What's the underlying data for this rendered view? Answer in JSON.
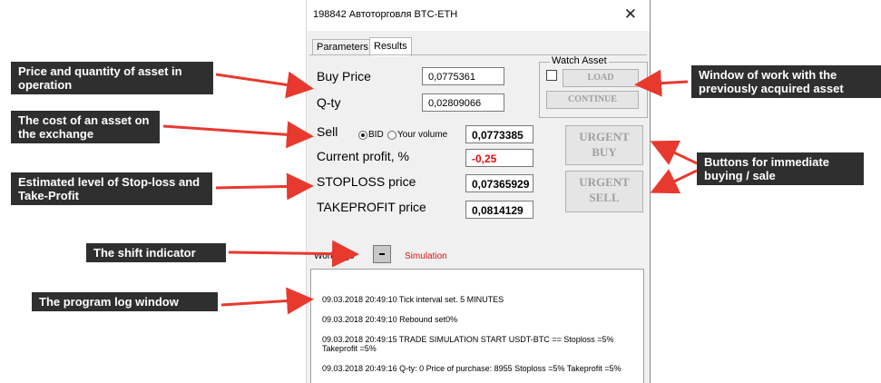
{
  "window": {
    "title": "198842 Автоторговля BTC-ETH",
    "close_glyph": "✕",
    "tabs": [
      {
        "label": "Parameters"
      },
      {
        "label": "Results"
      }
    ]
  },
  "results": {
    "buy_price_label": "Buy Price",
    "buy_price_value": "0,0775361",
    "qty_label": "Q-ty",
    "qty_value": "0,02809066",
    "watch_asset": {
      "legend": "Watch Asset",
      "load_label": "LOAD",
      "continue_label": "CONTINUE"
    },
    "sell_label": "Sell",
    "radio_bid": "BID",
    "radio_volume": "Your volume",
    "sell_value": "0,0773385",
    "current_profit_label": "Current profit, %",
    "current_profit_value": "-0,25",
    "stoploss_label": "STOPLOSS price",
    "stoploss_value": "0,07365929",
    "takeprofit_label": "TAKEPROFIT price",
    "takeprofit_value": "0,0814129",
    "urgent_buy_l1": "URGENT",
    "urgent_buy_l2": "BUY",
    "urgent_sell_l1": "URGENT",
    "urgent_sell_l2": "SELL",
    "work_logs_label": "Work logs",
    "mode_label": "Simulation"
  },
  "log": [
    "09.03.2018 20:49:10 Tick interval set. 5 MINUTES",
    "09.03.2018 20:49:10 Rebound set0%",
    "09.03.2018 20:49:15 TRADE SIMULATION START USDT-BTC == Stoploss =5% Takeprofit =5%",
    "09.03.2018 20:49:16 Q-ty: 0 Price of purchase: 8955 Stoploss =5% Takeprofit =5%"
  ],
  "callouts": {
    "price_qty": "Price and quantity of asset in operation",
    "cost": "The cost of an asset on the exchange",
    "stoploss": "Estimated level of Stop-loss and Take-Profit",
    "shift": "The shift indicator",
    "log_window": "The program log window",
    "watch_window": "Window of work with the previously acquired asset",
    "urgent_buttons": "Buttons for immediate buying / sale"
  },
  "colors": {
    "arrow": "#e8392f",
    "callout_bg": "#2f2f2f",
    "profit_negative": "#e01010",
    "mode_text": "#e01010"
  }
}
